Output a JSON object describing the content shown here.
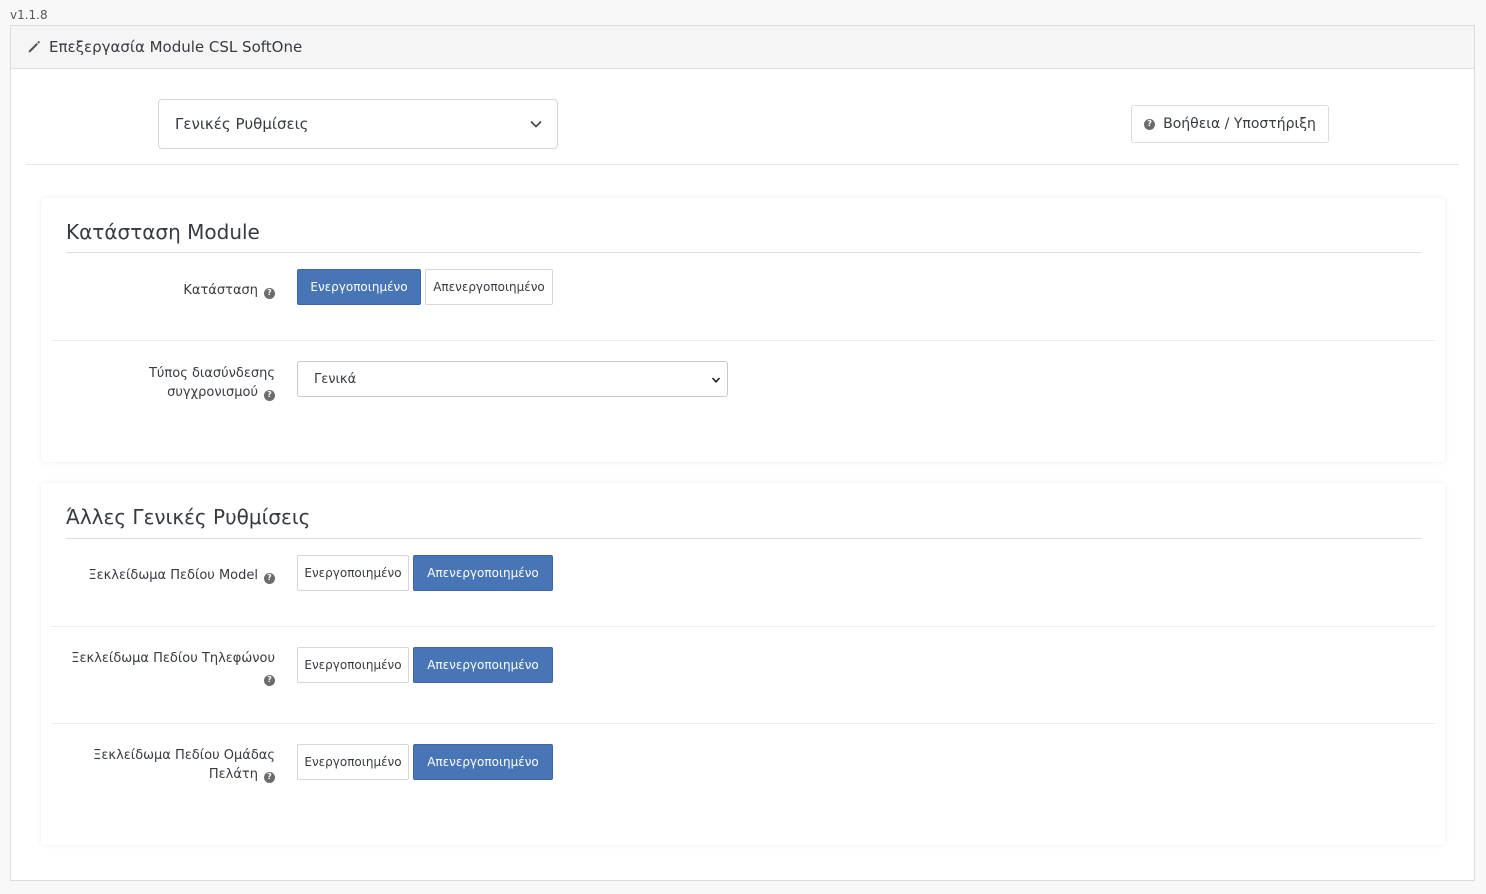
{
  "version": "v1.1.8",
  "header": {
    "title": "Επεξεργασία Module CSL SoftOne",
    "icon": "pencil-icon"
  },
  "top": {
    "section_select": "Γενικές Ρυθμίσεις",
    "help_label": "Βοήθεια / Υποστήριξη"
  },
  "colors": {
    "accent": "#4775b5"
  },
  "card1": {
    "title": "Κατάσταση Module",
    "status": {
      "label": "Κατάσταση",
      "on_label": "Ενεργοποιημένο",
      "off_label": "Απενεργοποιημένο",
      "selected": "on"
    },
    "sync": {
      "label_line1": "Τύπος διασύνδεσης",
      "label_line2": "συγχρονισμού",
      "value": "Γενικά"
    }
  },
  "card2": {
    "title": "Άλλες Γενικές Ρυθμίσεις",
    "model": {
      "label": "Ξεκλείδωμα Πεδίου Model",
      "on_label": "Ενεργοποιημένο",
      "off_label": "Απενεργοποιημένο",
      "selected": "off"
    },
    "phone": {
      "label_line1": "Ξεκλείδωμα Πεδίου Τηλεφώνου",
      "on_label": "Ενεργοποιημένο",
      "off_label": "Απενεργοποιημένο",
      "selected": "off"
    },
    "group": {
      "label_line1": "Ξεκλείδωμα Πεδίου Ομάδας",
      "label_line2": "Πελάτη",
      "on_label": "Ενεργοποιημένο",
      "off_label": "Απενεργοποιημένο",
      "selected": "off"
    }
  }
}
